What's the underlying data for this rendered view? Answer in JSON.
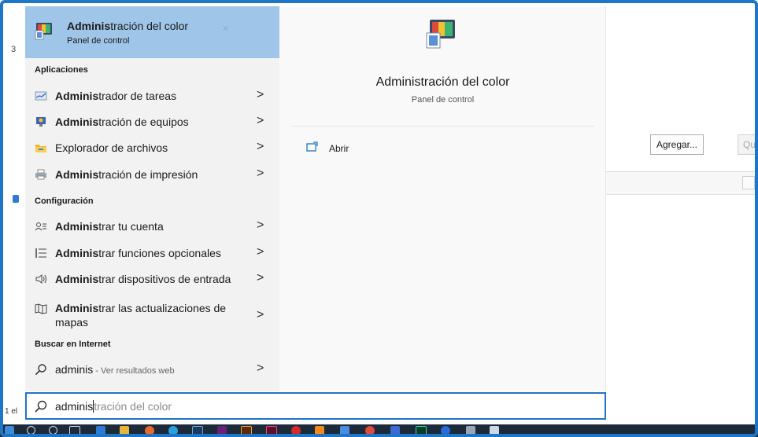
{
  "top_result": {
    "title_bold": "Adminis",
    "title_rest": "tración del color",
    "subtitle": "Panel de control"
  },
  "sections": {
    "apps": "Aplicaciones",
    "settings": "Configuración",
    "web": "Buscar en Internet"
  },
  "apps": [
    {
      "bold": "Adminis",
      "rest": "trador de tareas",
      "icon": "task-manager-icon"
    },
    {
      "bold": "Adminis",
      "rest": "tración de equipos",
      "icon": "computer-management-icon"
    },
    {
      "bold": "",
      "rest": "Explorador de archivos",
      "icon": "file-explorer-icon"
    },
    {
      "bold": "Adminis",
      "rest": "tración de impresión",
      "icon": "print-management-icon"
    }
  ],
  "settings": [
    {
      "bold": "Adminis",
      "rest": "trar tu cuenta",
      "icon": "account-icon"
    },
    {
      "bold": "Adminis",
      "rest": "trar funciones opcionales",
      "icon": "list-icon"
    },
    {
      "bold": "Adminis",
      "rest": "trar dispositivos de entrada",
      "icon": "speaker-icon"
    },
    {
      "bold": "Adminis",
      "rest": "trar las actualizaciones de mapas",
      "icon": "map-icon"
    }
  ],
  "web": {
    "query": "adminis",
    "suffix": " - Ver resultados web"
  },
  "detail": {
    "title": "Administración del color",
    "subtitle": "Panel de control",
    "open_label": "Abrir"
  },
  "search": {
    "typed": "adminis",
    "hint": "tración del color"
  },
  "background": {
    "add_button": "Agregar...",
    "remove_button": "Qu",
    "status": "1 el",
    "digit": "3"
  },
  "chevron": ">",
  "close_glyph": "×",
  "colors": {
    "accent": "#1f75c6",
    "selected": "#9fc5e8",
    "taskbar": "#1c2a3a"
  }
}
